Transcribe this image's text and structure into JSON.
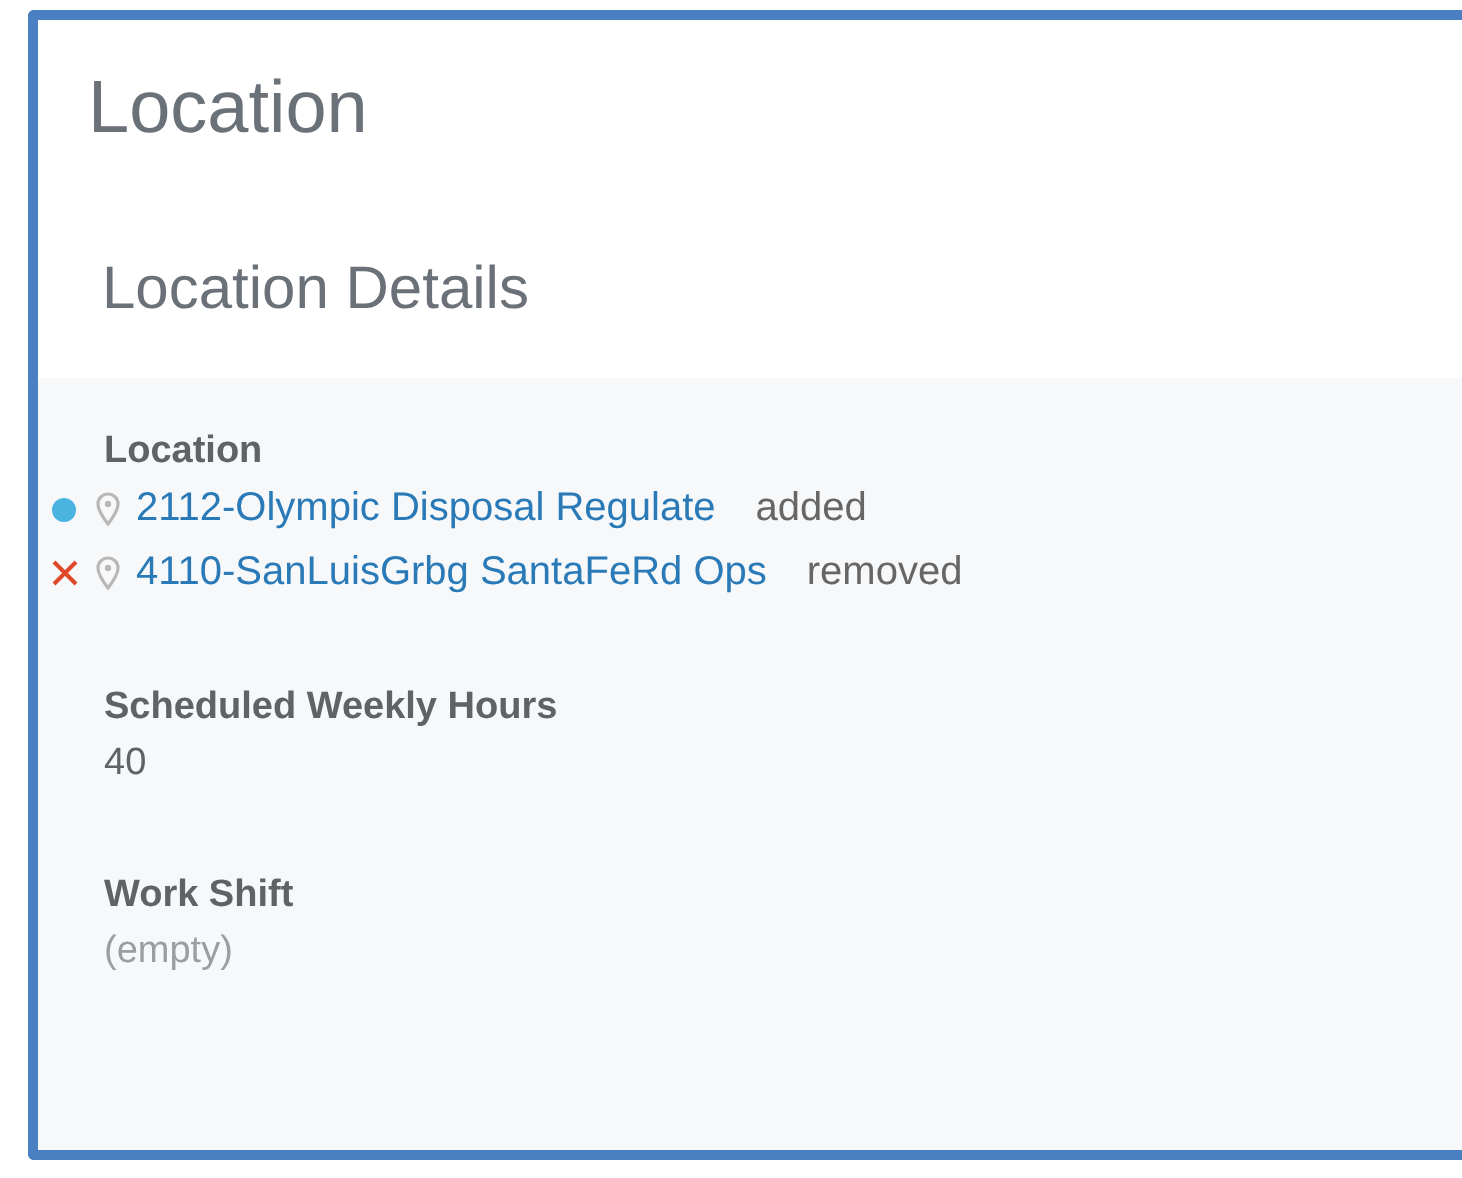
{
  "title": "Location",
  "section": {
    "title": "Location Details",
    "fields": [
      {
        "kind": "changes",
        "label": "Location",
        "changes": [
          {
            "kind": "added",
            "link": "2112-Olympic Disposal Regulate",
            "status": "added"
          },
          {
            "kind": "removed",
            "link": "4110-SanLuisGrbg SantaFeRd Ops",
            "status": "removed"
          }
        ]
      },
      {
        "kind": "text",
        "label": "Scheduled Weekly Hours",
        "value": "40"
      },
      {
        "kind": "empty",
        "label": "Work Shift",
        "value": "(empty)"
      }
    ]
  }
}
